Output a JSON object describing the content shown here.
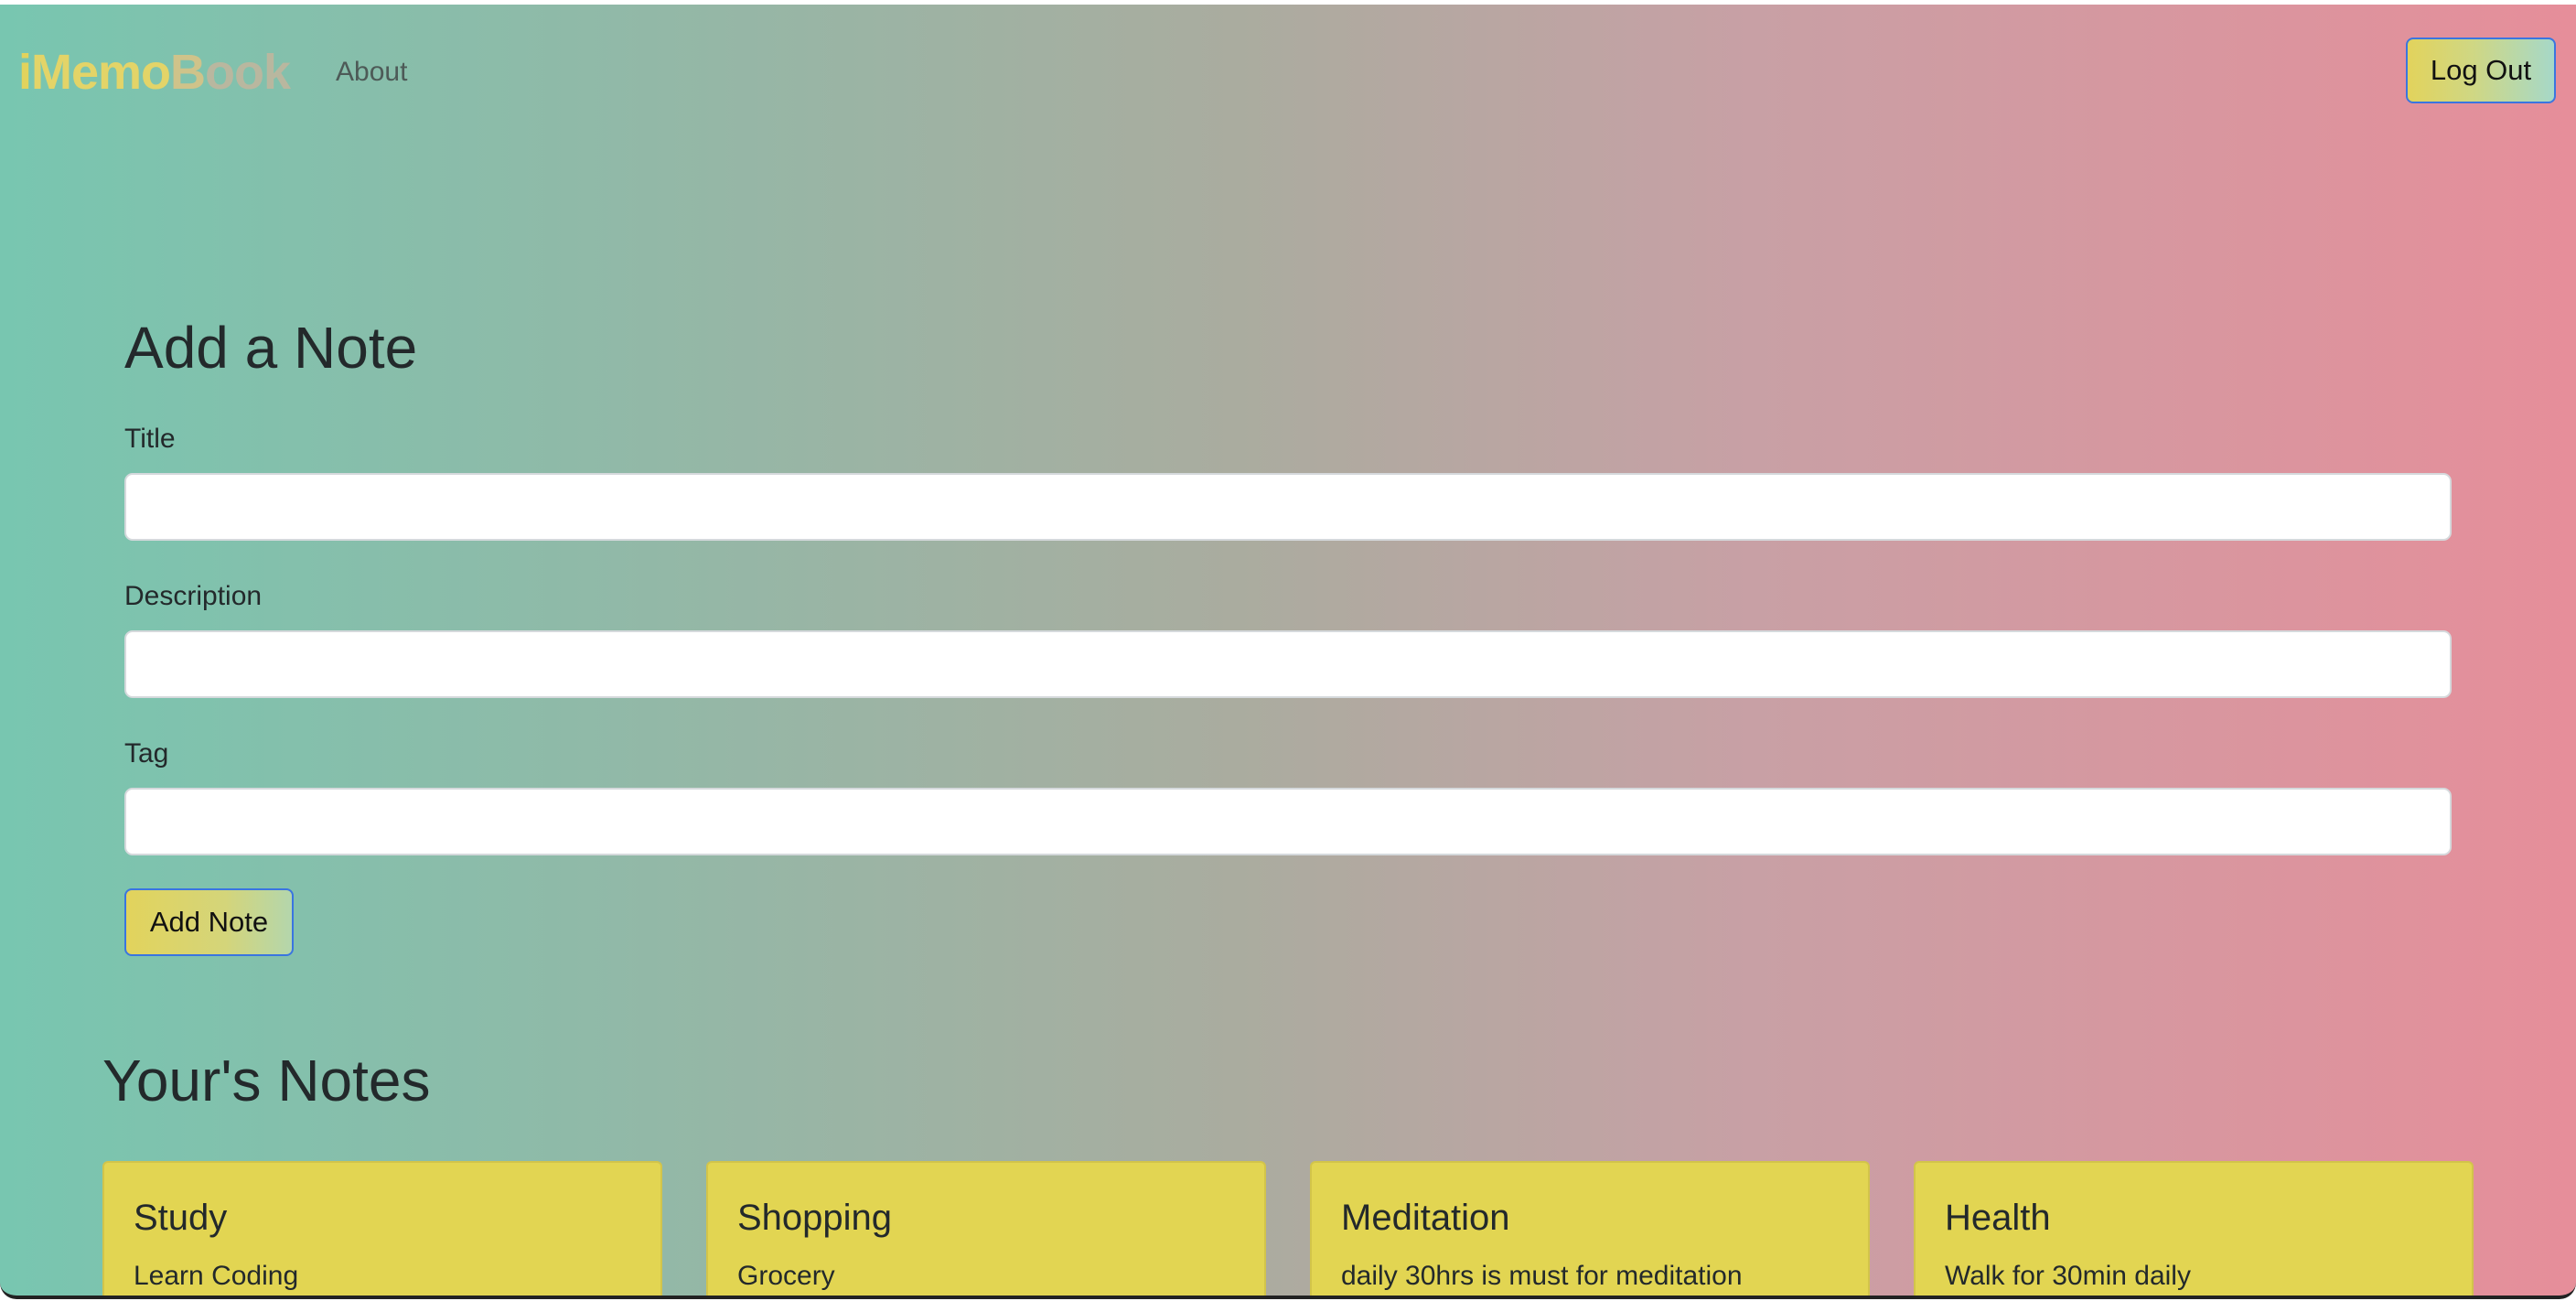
{
  "navbar": {
    "brand": {
      "part1": "i",
      "part2": "Memo",
      "part3": "B",
      "part4": "ook"
    },
    "about_label": "About",
    "logout_label": "Log Out"
  },
  "form": {
    "heading": "Add a Note",
    "title_label": "Title",
    "title_value": "",
    "description_label": "Description",
    "description_value": "",
    "tag_label": "Tag",
    "tag_value": "",
    "submit_label": "Add Note"
  },
  "notes": {
    "heading": "Your's Notes",
    "items": [
      {
        "title": "Study",
        "description": "Learn Coding"
      },
      {
        "title": "Shopping",
        "description": "Grocery"
      },
      {
        "title": "Meditation",
        "description": "daily 30hrs is must for meditation"
      },
      {
        "title": "Health",
        "description": "Walk for 30min daily"
      }
    ]
  },
  "colors": {
    "gradient_left": "#78c6b0",
    "gradient_right": "#e68e9a",
    "brand_yellow": "#e2d35c",
    "card_yellow": "#e2d552",
    "button_border": "#3a75e0"
  }
}
